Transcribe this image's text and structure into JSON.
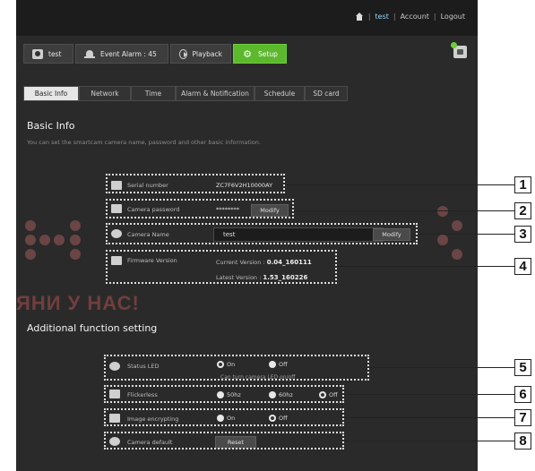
{
  "topbar": {
    "user": "test",
    "account": "Account",
    "logout": "Logout",
    "separator": "|"
  },
  "mainnav": {
    "camera": "test",
    "event_alarm": "Event Alarm : 45",
    "playback": "Playback",
    "setup": "Setup"
  },
  "subtabs": [
    "Basic Info",
    "Network",
    "Time",
    "Alarm & Notification",
    "Schedule",
    "SD card"
  ],
  "basic_info": {
    "title": "Basic Info",
    "description": "You can set the smartcam camera name, password and other basic information.",
    "serial_label": "Serial number",
    "serial_value": "ZC7F6V2H10000AY",
    "password_label": "Camera password",
    "password_value": "********",
    "modify_label": "Modify",
    "name_label": "Camera Name",
    "name_value": "test",
    "firmware_label": "Firmware Version",
    "current_prefix": "Current Version :",
    "current_version": "0.04_160111",
    "latest_prefix": "Latest Version :",
    "latest_version": "1.53_160226"
  },
  "additional": {
    "title": "Additional function setting",
    "status_led_label": "Status LED",
    "status_led_options": [
      "On",
      "Off"
    ],
    "status_led_selected": "On",
    "status_led_note": "Can turn camera LED on/off",
    "flickerless_label": "Flickerless",
    "flickerless_options": [
      "50hz",
      "60hz",
      "Off"
    ],
    "flickerless_selected": "Off",
    "encrypt_label": "Image encrypting",
    "encrypt_options": [
      "On",
      "Off"
    ],
    "encrypt_selected": "Off",
    "default_label": "Camera default",
    "reset_label": "Reset"
  },
  "callouts": [
    "1",
    "2",
    "3",
    "4",
    "5",
    "6",
    "7",
    "8"
  ],
  "watermark_text": "ЯНИ У НАС!",
  "colors": {
    "background": "#2a2a2a",
    "topbar": "#1c1c1c",
    "accent_green": "#5cb82d",
    "link_blue": "#8fd3ff",
    "callout_border": "#e0e0e0"
  }
}
